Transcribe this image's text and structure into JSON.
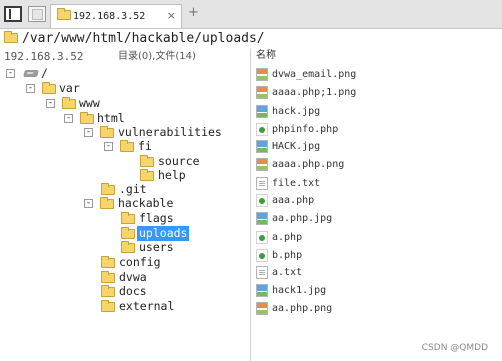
{
  "tab": {
    "title": "192.168.3.52",
    "close": "×",
    "add": "+"
  },
  "path": {
    "value": "/var/www/html/hackable/uploads/"
  },
  "status": {
    "ip": "192.168.3.52",
    "count": "目录(0),文件(14)"
  },
  "list_header": {
    "name": "名称"
  },
  "tree": [
    {
      "label": "/",
      "toggle": "-",
      "icon": "drive"
    },
    {
      "label": "var",
      "toggle": "-",
      "icon": "folder"
    },
    {
      "label": "www",
      "toggle": "-",
      "icon": "folder"
    },
    {
      "label": "html",
      "toggle": "-",
      "icon": "folder"
    },
    {
      "label": "vulnerabilities",
      "toggle": "-",
      "icon": "folder"
    },
    {
      "label": "fi",
      "toggle": "-",
      "icon": "folder"
    },
    {
      "label": "source",
      "toggle": "",
      "icon": "folder"
    },
    {
      "label": "help",
      "toggle": "",
      "icon": "folder"
    },
    {
      "label": ".git",
      "toggle": "",
      "icon": "folder"
    },
    {
      "label": "hackable",
      "toggle": "-",
      "icon": "folder"
    },
    {
      "label": "flags",
      "toggle": "",
      "icon": "folder"
    },
    {
      "label": "uploads",
      "toggle": "",
      "icon": "folder",
      "selected": true
    },
    {
      "label": "users",
      "toggle": "",
      "icon": "folder"
    },
    {
      "label": "config",
      "toggle": "",
      "icon": "folder"
    },
    {
      "label": "dvwa",
      "toggle": "",
      "icon": "folder"
    },
    {
      "label": "docs",
      "toggle": "",
      "icon": "folder"
    },
    {
      "label": "external",
      "toggle": "",
      "icon": "folder"
    }
  ],
  "files": [
    {
      "name": "dvwa_email.png",
      "icon": "img-png"
    },
    {
      "name": "aaaa.php;1.png",
      "icon": "img-png"
    },
    {
      "name": "hack.jpg",
      "icon": "img-jpg"
    },
    {
      "name": "phpinfo.php",
      "icon": "php"
    },
    {
      "name": "HACK.jpg",
      "icon": "img-jpg"
    },
    {
      "name": "aaaa.php.png",
      "icon": "img-png"
    },
    {
      "name": "file.txt",
      "icon": "txt"
    },
    {
      "name": "aaa.php",
      "icon": "php"
    },
    {
      "name": "aa.php.jpg",
      "icon": "img-jpg"
    },
    {
      "name": "a.php",
      "icon": "php"
    },
    {
      "name": "b.php",
      "icon": "php"
    },
    {
      "name": "a.txt",
      "icon": "txt"
    },
    {
      "name": "hack1.jpg",
      "icon": "img-jpg"
    },
    {
      "name": "aa.php.png",
      "icon": "img-png"
    }
  ],
  "watermark": "CSDN @QMDD"
}
